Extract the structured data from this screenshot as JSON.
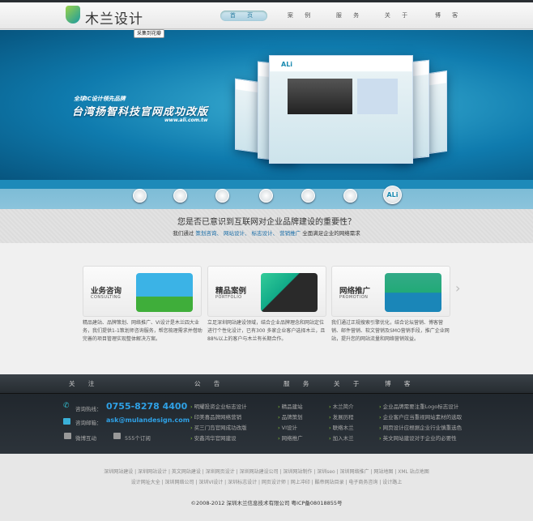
{
  "header": {
    "logo_text": "木兰设计",
    "nav": [
      "首 页",
      "案 例",
      "服 务",
      "关 于",
      "博 客"
    ],
    "pin_label": "采集到花瓣"
  },
  "banner": {
    "subtitle": "全球IC设计领先品牌",
    "title": "台湾扬智科技官网成功改版",
    "url": "www.ali.com.tw",
    "thumb_active": "ALi"
  },
  "intro": {
    "question": "您是否已意识到互联网对企业品牌建设的重要性？",
    "lead": "我们通过",
    "links": [
      "策划咨询、",
      "网站设计、",
      "标志设计、",
      "营销推广"
    ],
    "tail": "全面满足企业的网络需求"
  },
  "services": [
    {
      "title": "业务咨询",
      "en": "CONSULTING",
      "desc": "精品建站、品牌策划、网络推广、VI设计是木兰四大业务，我们提供1-1策划师咨询服务，帮您梳理需求并借助完善的项目管理实现整体解决方案。",
      "color": "#3fae3a"
    },
    {
      "title": "精品案例",
      "en": "PORTFOLIO",
      "desc": "立足深圳网站建设领域，结合企业品牌理念和网站定位进行个性化设计，已有300 多家企业客户选择木兰，且88%以上的客户与木兰有长期合作。",
      "color": "#2a2a2a"
    },
    {
      "title": "网络推广",
      "en": "PROMOTION",
      "desc": "我们通过正规搜索引擎优化，结合论坛营销、博客营销、邮件营销、软文营销及SMO营销手段，推广企业网站，提升您的网站流量和网络营销效益。",
      "color": "#1a86b8"
    }
  ],
  "footer": {
    "headings": [
      "关 注",
      "公 告",
      "服 务",
      "关 于",
      "博 客"
    ],
    "contact": {
      "phone_label": "咨询热线：",
      "phone": "0755-8278 4400",
      "email_label": "咨询邮箱：",
      "email": "ask@mulandesign.com",
      "weibo": "微博互动",
      "rss": "555个订阅"
    },
    "notices": [
      "明耀投资企业标志设计",
      "印美喜品牌网络营销",
      "买三门岛官网成功改版",
      "安鑫鸿华官网建设"
    ],
    "services": [
      "精品建站",
      "品牌策划",
      "VI设计",
      "网络推广"
    ],
    "about": [
      "木兰简介",
      "发展历程",
      "联络木兰",
      "加入木兰"
    ],
    "blog": [
      "企业品牌需要注重Logo标志设计",
      "企业客户应当重视网站素材的选取",
      "网页设计应根据企业行业慎重选色",
      "英文网站建设对于企业的必要性"
    ]
  },
  "bottom": {
    "links_line1": "深圳网站建设 | 深圳网站设计 | 英文网站建设 | 深圳网页设计 | 深圳网站建设公司 | 深圳网站制作 | 深圳seo | 深圳网络推广 | 网站地图 | XML 站点地图",
    "links_line2": "设计网址大全 | 深圳网络公司 | 深圳VI设计 | 深圳标志设计 | 网页设计师 | 网上冲印 | 酷帝网站目录 | 电子商务咨询 | 设计路上",
    "copyright": "©2008-2012 深圳木兰信息技术有限公司 粤ICP备08018855号"
  }
}
